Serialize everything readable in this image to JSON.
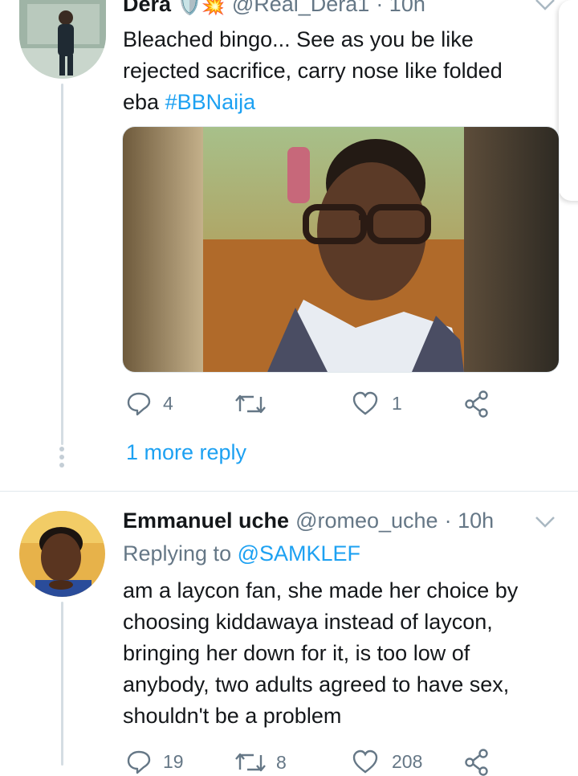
{
  "tweet1": {
    "name": "Dera",
    "emoji": "🛡️💥",
    "handle": "@Real_Dera1",
    "time": "· 10h",
    "text_lines": [
      "Bleached bingo...  See as you be like",
      "rejected sacrifice, carry nose like folded",
      "eba "
    ],
    "hashtag": "#BBNaija",
    "image_alt": "selfie-photo",
    "actions": {
      "replies": "4",
      "retweets": "",
      "likes": "1"
    },
    "more_replies": "1 more reply"
  },
  "tweet2": {
    "name": "Emmanuel uche",
    "handle": "@romeo_uche",
    "time": "· 10h",
    "replying_prefix": "Replying to ",
    "replying_to": "@SAMKLEF",
    "text_lines": [
      "am a laycon fan, she made her choice by",
      "choosing kiddawaya instead of laycon,",
      "bringing her down for it, is too low of",
      "anybody, two adults agreed to have sex,",
      "shouldn't be a problem"
    ],
    "actions": {
      "replies": "19",
      "retweets": "8",
      "likes": "208"
    }
  },
  "colors": {
    "accent": "#1da1f2",
    "muted": "#657786",
    "text": "#14171a"
  }
}
